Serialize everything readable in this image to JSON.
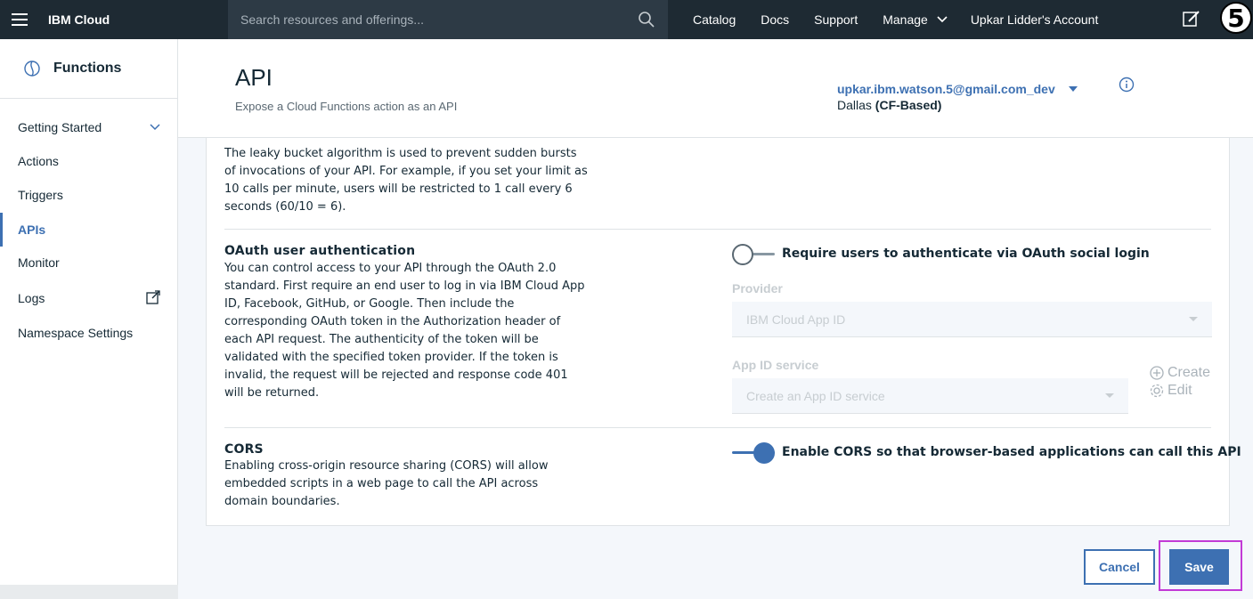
{
  "topbar": {
    "brand": "IBM Cloud",
    "search_placeholder": "Search resources and offerings...",
    "links": [
      "Catalog",
      "Docs",
      "Support"
    ],
    "manage": "Manage",
    "account": "Upkar Lidder's Account",
    "step_badge": "5",
    "bg_color": "#1e2a33"
  },
  "sidebar": {
    "title": "Functions",
    "items": [
      {
        "label": "Getting Started"
      },
      {
        "label": "Actions"
      },
      {
        "label": "Triggers"
      },
      {
        "label": "APIs"
      },
      {
        "label": "Monitor"
      },
      {
        "label": "Logs"
      },
      {
        "label": "Namespace Settings"
      }
    ],
    "active": "APIs"
  },
  "header": {
    "title": "API",
    "subtitle": "Expose a Cloud Functions action as an API",
    "namespace": "upkar.ibm.watson.5@gmail.com_dev",
    "region_prefix": "Dallas ",
    "region_suffix": "(CF-Based)"
  },
  "rate_limit": {
    "description": "The leaky bucket algorithm is used to prevent sudden bursts of invocations of your API. For example, if you set your limit as 10 calls per minute, users will be restricted to 1 call every 6 seconds (60/10 = 6)."
  },
  "oauth": {
    "title": "OAuth user authentication",
    "description": "You can control access to your API through the OAuth 2.0 standard. First require an end user to log in via IBM Cloud App ID, Facebook, GitHub, or Google. Then include the corresponding OAuth token in the Authorization header of each API request. The authenticity of the token will be validated with the specified token provider. If the token is invalid, the request will be rejected and response code 401 will be returned.",
    "toggle_label": "Require users to authenticate via OAuth social login",
    "toggle_on": false,
    "provider_label": "Provider",
    "provider_value": "IBM Cloud App ID",
    "appid_label": "App ID service",
    "appid_value": "Create an App ID service",
    "create_label": "Create",
    "edit_label": "Edit"
  },
  "cors": {
    "title": "CORS",
    "description": "Enabling cross-origin resource sharing (CORS) will allow embedded scripts in a web page to call the API across domain boundaries.",
    "toggle_label": "Enable CORS so that browser-based applications can call this API",
    "toggle_on": true
  },
  "footer": {
    "cancel_label": "Cancel",
    "save_label": "Save"
  },
  "colors": {
    "accent": "#3d70b2",
    "highlight": "#c23ad6"
  }
}
